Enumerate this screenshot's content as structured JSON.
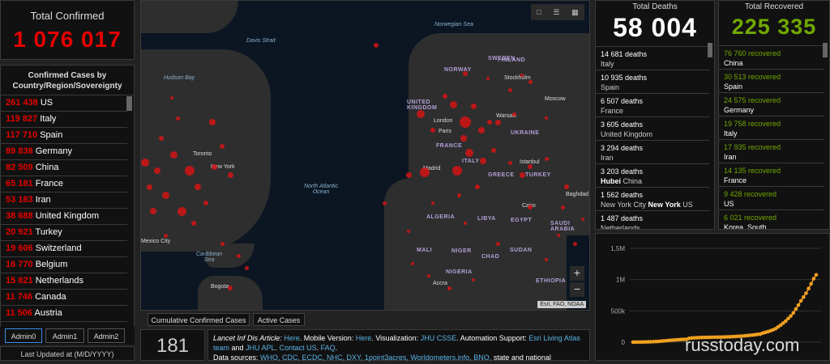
{
  "total": {
    "label": "Total Confirmed",
    "value": "1 076 017"
  },
  "cases": {
    "header": "Confirmed Cases by Country/Region/Sovereignty",
    "rows": [
      {
        "n": "261 438",
        "name": "US"
      },
      {
        "n": "119 827",
        "name": "Italy"
      },
      {
        "n": "117 710",
        "name": "Spain"
      },
      {
        "n": "89 838",
        "name": "Germany"
      },
      {
        "n": "82 509",
        "name": "China"
      },
      {
        "n": "65 181",
        "name": "France"
      },
      {
        "n": "53 183",
        "name": "Iran"
      },
      {
        "n": "38 688",
        "name": "United Kingdom"
      },
      {
        "n": "20 921",
        "name": "Turkey"
      },
      {
        "n": "19 606",
        "name": "Switzerland"
      },
      {
        "n": "16 770",
        "name": "Belgium"
      },
      {
        "n": "15 821",
        "name": "Netherlands"
      },
      {
        "n": "11 746",
        "name": "Canada"
      },
      {
        "n": "11 506",
        "name": "Austria"
      }
    ]
  },
  "admin_tabs": [
    "Admin0",
    "Admin1",
    "Admin2"
  ],
  "updated": "Last Updated at (M/D/YYYY)",
  "map": {
    "tabs": [
      "Cumulative Confirmed Cases",
      "Active Cases"
    ],
    "attribution": "Esri, FAO, NOAA",
    "zoom_in": "+",
    "zoom_out": "−",
    "labels": {
      "davis": "Davis Strait",
      "hudson": "Hudson Bay",
      "norwegian": "Norwegian Sea",
      "atlantic": "North Atlantic Ocean",
      "caribbean": "Caribbean Sea",
      "sweden": "SWEDEN",
      "finland": "FINLAND",
      "norway": "NORWAY",
      "uk": "UNITED KINGDOM",
      "ukraine": "UKRAINE",
      "france": "FRANCE",
      "italy": "ITALY",
      "turkey": "TURKEY",
      "algeria": "ALGERIA",
      "libya": "LIBYA",
      "egypt": "EGYPT",
      "mali": "MALI",
      "niger": "NIGER",
      "chad": "CHAD",
      "sudan": "SUDAN",
      "nigeria": "NIGERIA",
      "ethiopia": "ETHIOPIA",
      "saudi": "SAUDI ARABIA",
      "greece": "GREECE",
      "moscow": "Moscow",
      "stockholm": "Stockholm",
      "london": "London",
      "paris": "Paris",
      "warsaw": "Warsaw",
      "madrid": "Madrid",
      "istanbul": "Istanbul",
      "baghdad": "Baghdad",
      "cairo": "Cairo",
      "toronto": "Toronto",
      "newyork": "New York",
      "mexico": "Mexico City",
      "bogota": "Bogota",
      "accra": "Accra"
    }
  },
  "counter": "181",
  "info": {
    "a": "Lancet Inf Dis Article:",
    "here1": "Here",
    "b": ". Mobile Version:",
    "here2": "Here",
    "c": ". Visualization:",
    "jhu": "JHU CSSE",
    "d": ". Automation Support:",
    "esri": "Esri Living Atlas team",
    "e": " and ",
    "apl": "JHU APL",
    "f": ". ",
    "contact": "Contact US",
    "g": ". ",
    "faq": "FAQ",
    "h": ".",
    "sources_label": "Data sources:",
    "sources": "WHO, CDC, ECDC, NHC, DXY, 1point3acres, Worldometers.info, BNO,",
    "tail": "state and national"
  },
  "deaths": {
    "label": "Total Deaths",
    "value": "58 004",
    "rows": [
      {
        "n": "14 681 deaths",
        "place": "Italy"
      },
      {
        "n": "10 935 deaths",
        "place": "Spain"
      },
      {
        "n": "6 507 deaths",
        "place": "France"
      },
      {
        "n": "3 605 deaths",
        "place": "United Kingdom"
      },
      {
        "n": "3 294 deaths",
        "place": "Iran"
      },
      {
        "n": "3 203 deaths",
        "bold": "Hubei",
        "place": "China"
      },
      {
        "n": "1 562 deaths",
        "place": "New York City",
        "bold": "New York",
        "suffix": "US"
      },
      {
        "n": "1 487 deaths",
        "place": "Netherlands"
      }
    ]
  },
  "recovered": {
    "label": "Total Recovered",
    "value": "225 335",
    "rows": [
      {
        "n": "76 760 recovered",
        "place": "China"
      },
      {
        "n": "30 513 recovered",
        "place": "Spain"
      },
      {
        "n": "24 575 recovered",
        "place": "Germany"
      },
      {
        "n": "19 758 recovered",
        "place": "Italy"
      },
      {
        "n": "17 935 recovered",
        "place": "Iran"
      },
      {
        "n": "14 135 recovered",
        "place": "France"
      },
      {
        "n": "9 428 recovered",
        "place": "US"
      },
      {
        "n": "6 021 recovered",
        "place": "Korea, South"
      }
    ]
  },
  "chart_data": {
    "type": "line",
    "y_ticks": [
      "1,5M",
      "1M",
      "500k",
      "0"
    ],
    "ylim": [
      0,
      1500000
    ],
    "values": [
      555,
      654,
      941,
      1434,
      2118,
      2927,
      5578,
      6166,
      8234,
      9927,
      12038,
      16787,
      19881,
      23892,
      27635,
      30794,
      34391,
      37120,
      40150,
      42762,
      44802,
      45221,
      60368,
      66885,
      69030,
      71224,
      73258,
      75136,
      75639,
      76197,
      76819,
      78572,
      78958,
      79561,
      80406,
      81388,
      82746,
      84112,
      86011,
      88369,
      90306,
      92840,
      95120,
      97886,
      101801,
      105847,
      109821,
      113590,
      118620,
      125875,
      128352,
      145205,
      156101,
      167454,
      181574,
      197102,
      214821,
      242570,
      272208,
      304507,
      336953,
      378235,
      418045,
      467653,
      529591,
      593291,
      660706,
      720117,
      782365,
      857487,
      932605,
      1015000,
      1076017
    ],
    "line_color": "#f0a020"
  },
  "watermark": "russtoday.com"
}
